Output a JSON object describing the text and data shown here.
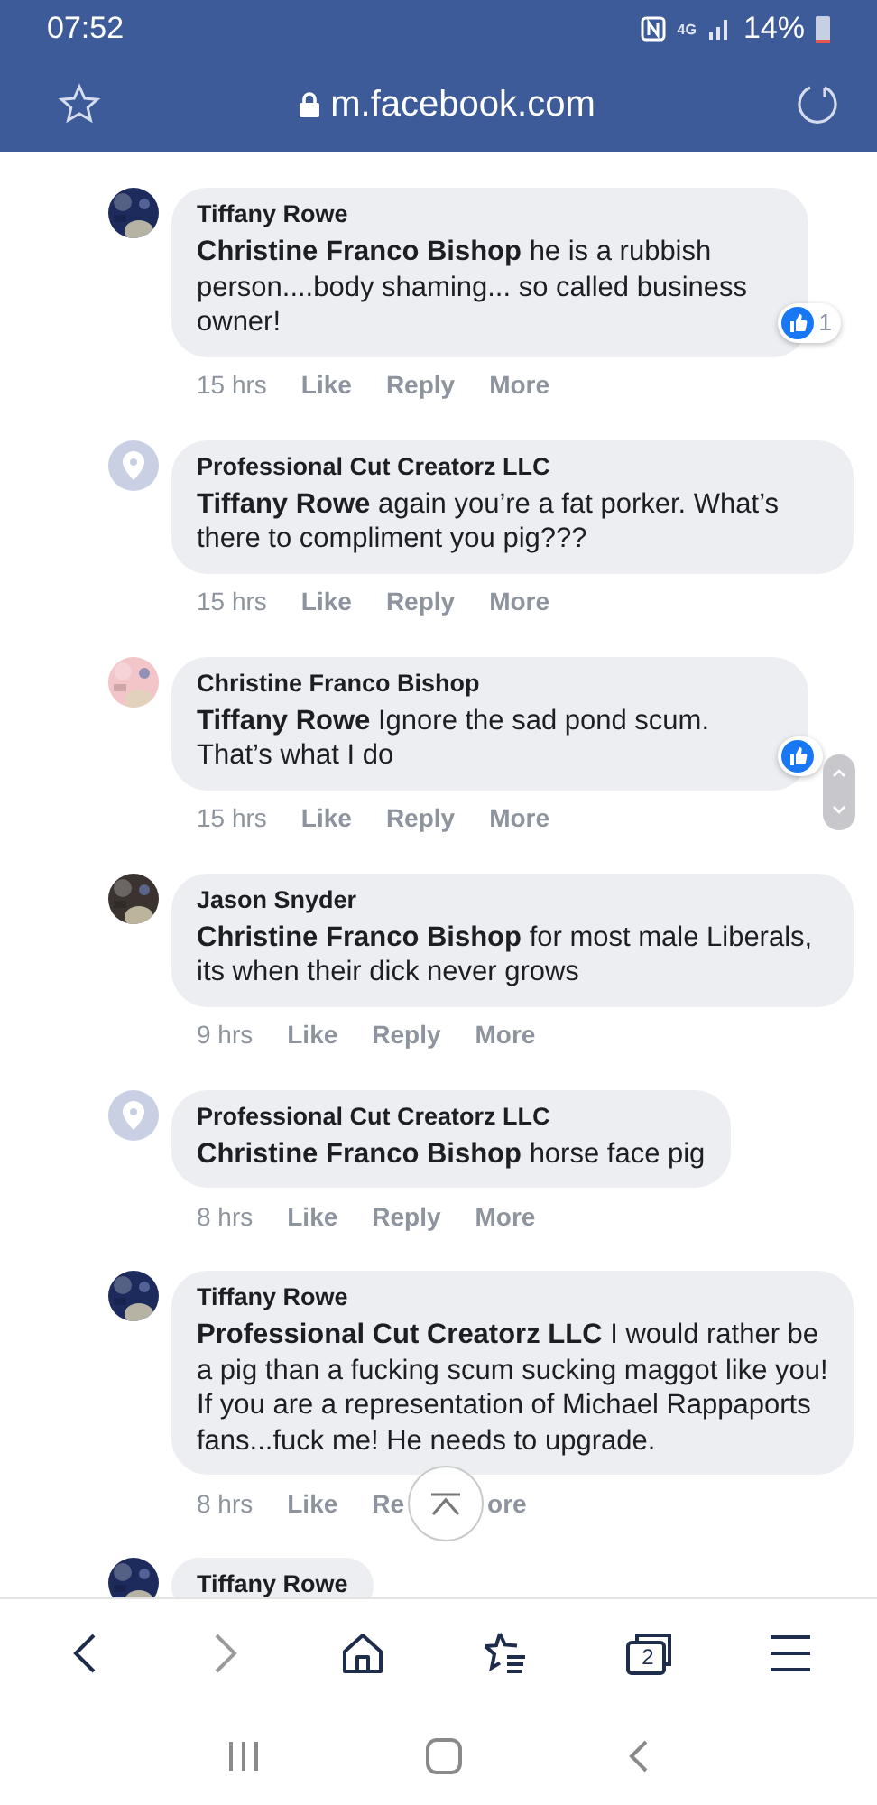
{
  "status_bar": {
    "time": "07:52",
    "network": "4G",
    "battery": "14%"
  },
  "url_bar": {
    "url": "m.facebook.com"
  },
  "comments": [
    {
      "author": "Tiffany Rowe",
      "mention": "Christine Franco Bishop",
      "text": "he is a rubbish person....body shaming... so called business owner!",
      "time": "15 hrs",
      "actions": [
        "Like",
        "Reply",
        "More"
      ],
      "reaction": {
        "count": "1"
      }
    },
    {
      "author": "Professional Cut Creatorz LLC",
      "avatar": {
        "kind": "default",
        "color": "#c9d0e3"
      },
      "mention": "Tiffany Rowe",
      "text": "again you’re a fat porker. What’s there to compliment you pig???",
      "time": "15 hrs",
      "actions": [
        "Like",
        "Reply",
        "More"
      ]
    },
    {
      "author": "Christine Franco Bishop",
      "mention": "Tiffany Rowe",
      "text": "Ignore the sad pond scum. That’s what I do",
      "time": "15 hrs",
      "actions": [
        "Like",
        "Reply",
        "More"
      ],
      "reaction": {
        "scroller": true
      }
    },
    {
      "author": "Jason Snyder",
      "mention": "Christine Franco Bishop",
      "text": "for most male Liberals, its when their dick never grows",
      "time": "9 hrs",
      "actions": [
        "Like",
        "Reply",
        "More"
      ]
    },
    {
      "author": "Professional Cut Creatorz LLC",
      "avatar": {
        "kind": "default",
        "color": "#c9d0e3"
      },
      "mention": "Christine Franco Bishop",
      "text": "horse face pig",
      "time": "8 hrs",
      "actions": [
        "Like",
        "Reply",
        "More"
      ]
    },
    {
      "author": "Tiffany Rowe",
      "mention": "Professional Cut Creatorz LLC",
      "text": "I would rather be a pig than a fucking scum sucking maggot like you! If you are a representation of Michael Rappaports fans...fuck me! He needs to upgrade.",
      "time": "8 hrs",
      "actions": [
        "Like",
        "Re",
        "ore"
      ],
      "scroll_top_button": true
    },
    {
      "author": "Tiffany Rowe"
    }
  ],
  "toolbar": {
    "back_disabled": false,
    "forward_disabled": true,
    "tab_count": "2"
  }
}
